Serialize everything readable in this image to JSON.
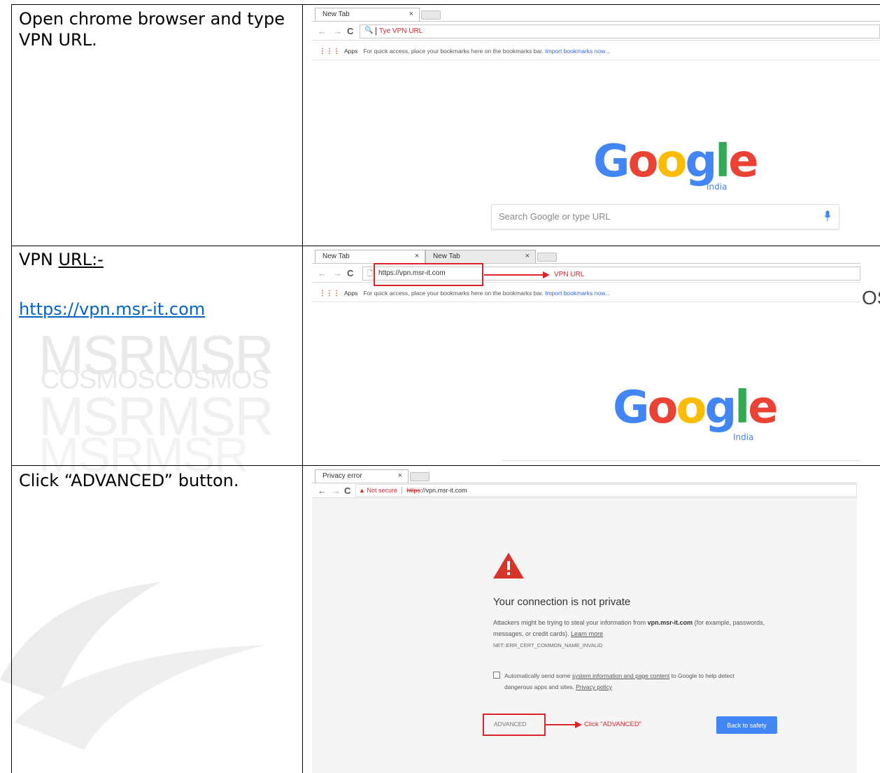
{
  "steps": [
    {
      "text": "Open chrome browser and type VPN URL.",
      "screenshot": {
        "tabs": [
          {
            "label": "New Tab",
            "close": "×"
          }
        ],
        "omnibox_text": "Tye VPN URL",
        "bookmarks": {
          "apps": "Apps",
          "hint": "For quick access, place your bookmarks here on the bookmarks bar.",
          "import": "Import bookmarks now..."
        },
        "google": {
          "letters": [
            "G",
            "o",
            "o",
            "g",
            "l",
            "e"
          ],
          "region": "India"
        },
        "search_placeholder": "Search Google or type URL"
      }
    },
    {
      "text_prefix": "VPN ",
      "text_url_word": "URL:-",
      "link": "https://vpn.msr-it.com",
      "screenshot": {
        "tabs": [
          {
            "label": "New Tab",
            "close": "×"
          },
          {
            "label": "New Tab",
            "close": "×"
          }
        ],
        "omnibox_text": "https://vpn.msr-it.com",
        "callout": "VPN URL",
        "bookmarks": {
          "apps": "Apps",
          "hint": "For quick access, place your bookmarks here on the bookmarks bar.",
          "import": "Import bookmarks now..."
        },
        "google": {
          "letters": [
            "G",
            "o",
            "o",
            "g",
            "l",
            "e"
          ],
          "region": "India"
        }
      }
    },
    {
      "text": "Click “ADVANCED” button.",
      "screenshot": {
        "tabs": [
          {
            "label": "Privacy error",
            "close": "×"
          }
        ],
        "not_secure": "Not secure",
        "url_scheme": "https",
        "url_rest": "://vpn.msr-it.com",
        "title": "Your connection is not private",
        "body_before": "Attackers might be trying to steal your information from ",
        "body_host": "vpn.msr-it.com",
        "body_after": " (for example, passwords, messages, or credit cards). ",
        "learn_more": "Learn more",
        "error_code": "NET::ERR_CERT_COMMON_NAME_INVALID",
        "checkbox_before": "Automatically send some ",
        "checkbox_link": "system information and page content",
        "checkbox_after": " to Google to help detect dangerous apps and sites. ",
        "privacy_policy": "Privacy policy",
        "advanced_button": "ADVANCED",
        "callout": "Click \"ADVANCED\"",
        "back_button": "Back to safety"
      }
    }
  ],
  "watermark": {
    "line1": "MSRMSR",
    "line2": "COSMOSCOSMOS",
    "line3": "MSRMSR",
    "line4": "MSRMSR",
    "edge": "OS"
  },
  "colors": {
    "red": "#d9242a",
    "blue": "#4285f4",
    "google": [
      "#4285f4",
      "#ea4335",
      "#fbbc05",
      "#4285f4",
      "#34a853",
      "#ea4335"
    ]
  }
}
